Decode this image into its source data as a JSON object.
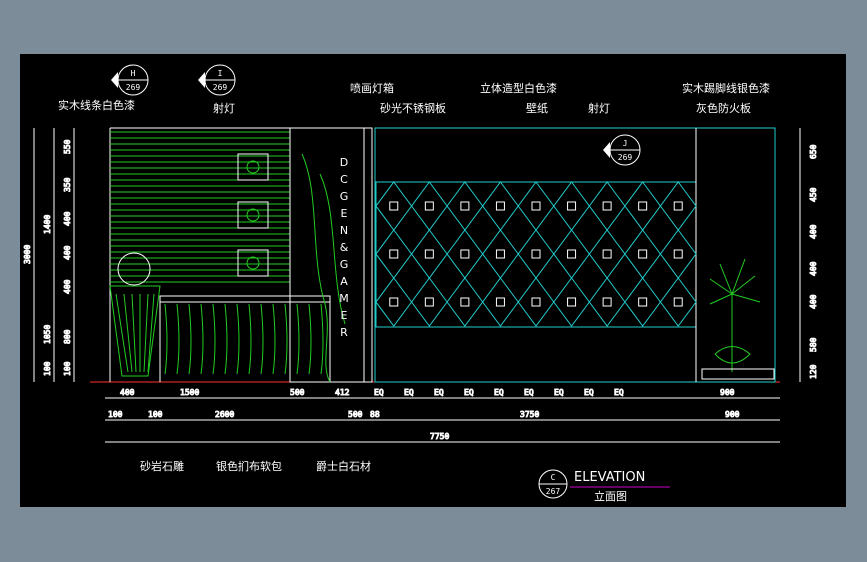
{
  "callouts": {
    "top": [
      "实木线条白色漆",
      "射灯",
      "喷画灯箱",
      "砂光不锈钢板",
      "立体造型白色漆",
      "壁纸",
      "射灯",
      "实木踢脚线银色漆",
      "灰色防火板"
    ],
    "bottom": [
      "砂岩石雕",
      "银色扪布软包",
      "爵士白石材"
    ]
  },
  "markers": [
    {
      "letter": "H",
      "num": "269"
    },
    {
      "letter": "I",
      "num": "269"
    },
    {
      "letter": "J",
      "num": "269"
    }
  ],
  "title_marker": {
    "letter": "C",
    "num": "267"
  },
  "title": {
    "en": "ELEVATION",
    "cn": "立面图"
  },
  "vertical_text": [
    "D",
    "C",
    "G",
    "E",
    "N",
    "&",
    "G",
    "A",
    "M",
    "E",
    "R"
  ],
  "left_dims_outer": [
    "3000"
  ],
  "left_dims_mid": [
    "1400",
    "1050",
    "100"
  ],
  "left_dims_inner": [
    "550",
    "350",
    "400",
    "400",
    "400",
    "800",
    "100"
  ],
  "right_dims": [
    "650",
    "450",
    "400",
    "400",
    "400",
    "580",
    "120"
  ],
  "bottom_dims_row1": [
    "400",
    "1500",
    "500",
    "412",
    "EQ",
    "EQ",
    "EQ",
    "EQ",
    "EQ",
    "EQ",
    "EQ",
    "EQ",
    "EQ",
    "900"
  ],
  "bottom_dims_row2": [
    "100",
    "100",
    "2600",
    "500",
    "88",
    "3750",
    "900"
  ],
  "bottom_dims_total": "7750"
}
